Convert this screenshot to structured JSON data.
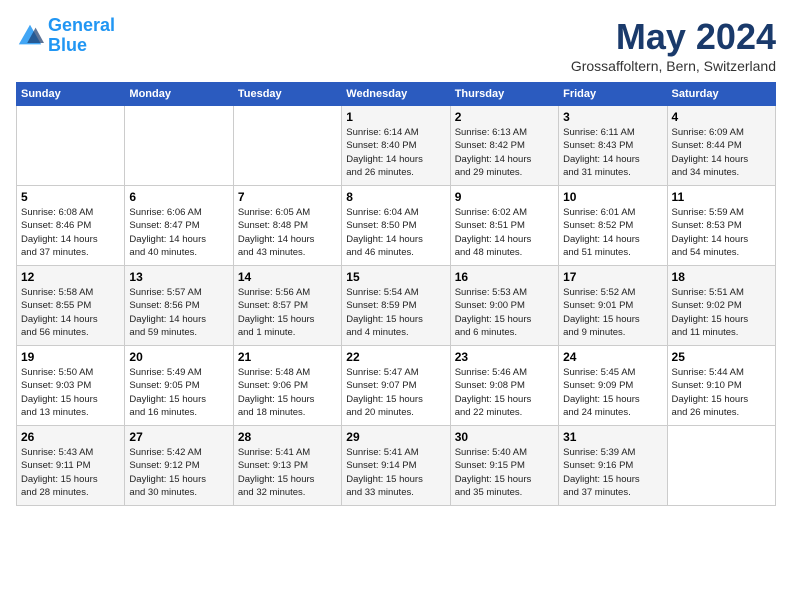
{
  "header": {
    "logo_text_general": "General",
    "logo_text_blue": "Blue",
    "month_title": "May 2024",
    "subtitle": "Grossaffoltern, Bern, Switzerland"
  },
  "days_header": [
    "Sunday",
    "Monday",
    "Tuesday",
    "Wednesday",
    "Thursday",
    "Friday",
    "Saturday"
  ],
  "weeks": [
    [
      {
        "day": "",
        "info": ""
      },
      {
        "day": "",
        "info": ""
      },
      {
        "day": "",
        "info": ""
      },
      {
        "day": "1",
        "info": "Sunrise: 6:14 AM\nSunset: 8:40 PM\nDaylight: 14 hours\nand 26 minutes."
      },
      {
        "day": "2",
        "info": "Sunrise: 6:13 AM\nSunset: 8:42 PM\nDaylight: 14 hours\nand 29 minutes."
      },
      {
        "day": "3",
        "info": "Sunrise: 6:11 AM\nSunset: 8:43 PM\nDaylight: 14 hours\nand 31 minutes."
      },
      {
        "day": "4",
        "info": "Sunrise: 6:09 AM\nSunset: 8:44 PM\nDaylight: 14 hours\nand 34 minutes."
      }
    ],
    [
      {
        "day": "5",
        "info": "Sunrise: 6:08 AM\nSunset: 8:46 PM\nDaylight: 14 hours\nand 37 minutes."
      },
      {
        "day": "6",
        "info": "Sunrise: 6:06 AM\nSunset: 8:47 PM\nDaylight: 14 hours\nand 40 minutes."
      },
      {
        "day": "7",
        "info": "Sunrise: 6:05 AM\nSunset: 8:48 PM\nDaylight: 14 hours\nand 43 minutes."
      },
      {
        "day": "8",
        "info": "Sunrise: 6:04 AM\nSunset: 8:50 PM\nDaylight: 14 hours\nand 46 minutes."
      },
      {
        "day": "9",
        "info": "Sunrise: 6:02 AM\nSunset: 8:51 PM\nDaylight: 14 hours\nand 48 minutes."
      },
      {
        "day": "10",
        "info": "Sunrise: 6:01 AM\nSunset: 8:52 PM\nDaylight: 14 hours\nand 51 minutes."
      },
      {
        "day": "11",
        "info": "Sunrise: 5:59 AM\nSunset: 8:53 PM\nDaylight: 14 hours\nand 54 minutes."
      }
    ],
    [
      {
        "day": "12",
        "info": "Sunrise: 5:58 AM\nSunset: 8:55 PM\nDaylight: 14 hours\nand 56 minutes."
      },
      {
        "day": "13",
        "info": "Sunrise: 5:57 AM\nSunset: 8:56 PM\nDaylight: 14 hours\nand 59 minutes."
      },
      {
        "day": "14",
        "info": "Sunrise: 5:56 AM\nSunset: 8:57 PM\nDaylight: 15 hours\nand 1 minute."
      },
      {
        "day": "15",
        "info": "Sunrise: 5:54 AM\nSunset: 8:59 PM\nDaylight: 15 hours\nand 4 minutes."
      },
      {
        "day": "16",
        "info": "Sunrise: 5:53 AM\nSunset: 9:00 PM\nDaylight: 15 hours\nand 6 minutes."
      },
      {
        "day": "17",
        "info": "Sunrise: 5:52 AM\nSunset: 9:01 PM\nDaylight: 15 hours\nand 9 minutes."
      },
      {
        "day": "18",
        "info": "Sunrise: 5:51 AM\nSunset: 9:02 PM\nDaylight: 15 hours\nand 11 minutes."
      }
    ],
    [
      {
        "day": "19",
        "info": "Sunrise: 5:50 AM\nSunset: 9:03 PM\nDaylight: 15 hours\nand 13 minutes."
      },
      {
        "day": "20",
        "info": "Sunrise: 5:49 AM\nSunset: 9:05 PM\nDaylight: 15 hours\nand 16 minutes."
      },
      {
        "day": "21",
        "info": "Sunrise: 5:48 AM\nSunset: 9:06 PM\nDaylight: 15 hours\nand 18 minutes."
      },
      {
        "day": "22",
        "info": "Sunrise: 5:47 AM\nSunset: 9:07 PM\nDaylight: 15 hours\nand 20 minutes."
      },
      {
        "day": "23",
        "info": "Sunrise: 5:46 AM\nSunset: 9:08 PM\nDaylight: 15 hours\nand 22 minutes."
      },
      {
        "day": "24",
        "info": "Sunrise: 5:45 AM\nSunset: 9:09 PM\nDaylight: 15 hours\nand 24 minutes."
      },
      {
        "day": "25",
        "info": "Sunrise: 5:44 AM\nSunset: 9:10 PM\nDaylight: 15 hours\nand 26 minutes."
      }
    ],
    [
      {
        "day": "26",
        "info": "Sunrise: 5:43 AM\nSunset: 9:11 PM\nDaylight: 15 hours\nand 28 minutes."
      },
      {
        "day": "27",
        "info": "Sunrise: 5:42 AM\nSunset: 9:12 PM\nDaylight: 15 hours\nand 30 minutes."
      },
      {
        "day": "28",
        "info": "Sunrise: 5:41 AM\nSunset: 9:13 PM\nDaylight: 15 hours\nand 32 minutes."
      },
      {
        "day": "29",
        "info": "Sunrise: 5:41 AM\nSunset: 9:14 PM\nDaylight: 15 hours\nand 33 minutes."
      },
      {
        "day": "30",
        "info": "Sunrise: 5:40 AM\nSunset: 9:15 PM\nDaylight: 15 hours\nand 35 minutes."
      },
      {
        "day": "31",
        "info": "Sunrise: 5:39 AM\nSunset: 9:16 PM\nDaylight: 15 hours\nand 37 minutes."
      },
      {
        "day": "",
        "info": ""
      }
    ]
  ]
}
